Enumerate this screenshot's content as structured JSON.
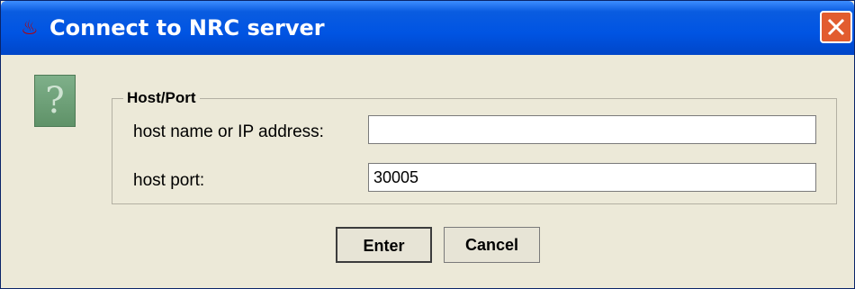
{
  "window": {
    "title": "Connect to NRC server",
    "title_icon": "java-cup-icon",
    "close_icon": "close-icon"
  },
  "dialog": {
    "icon": "question-icon",
    "group_title": "Host/Port",
    "host_label": "host name or IP address:",
    "host_value": "",
    "port_label": "host port:",
    "port_value": "30005"
  },
  "buttons": {
    "enter_label": "Enter",
    "cancel_label": "Cancel"
  },
  "colors": {
    "titlebar": "#0054e3",
    "close_button": "#e25c2f",
    "dialog_background": "#ece9d8",
    "question_icon": "#6f9f79"
  }
}
